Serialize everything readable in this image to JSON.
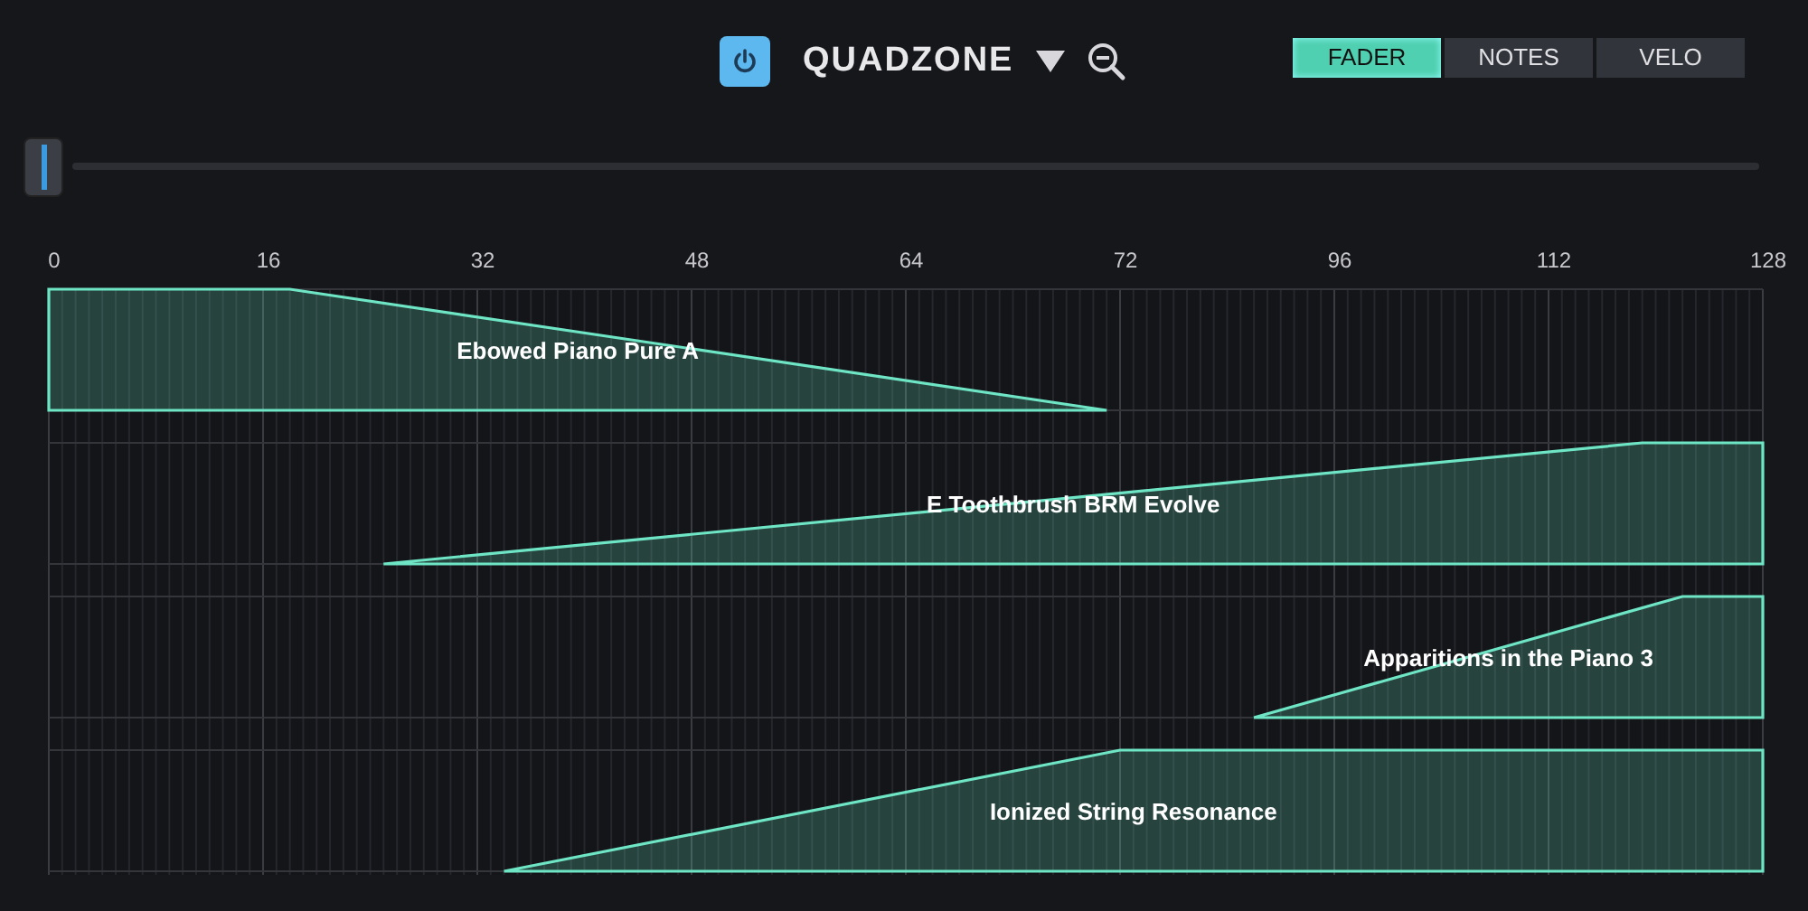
{
  "header": {
    "power": {
      "on": true
    },
    "title": "QUADZONE"
  },
  "tabs": [
    {
      "label": "FADER",
      "selected": true
    },
    {
      "label": "NOTES",
      "selected": false
    },
    {
      "label": "VELO",
      "selected": false
    }
  ],
  "ruler": [
    "0",
    "16",
    "32",
    "48",
    "64",
    "72",
    "96",
    "112",
    "128"
  ],
  "zones": [
    {
      "name": "Ebowed Piano Pure  A"
    },
    {
      "name": "E Toothbrush BRM Evolve"
    },
    {
      "name": "Apparitions in the Piano 3"
    },
    {
      "name": "Ionized String Resonance"
    }
  ]
}
